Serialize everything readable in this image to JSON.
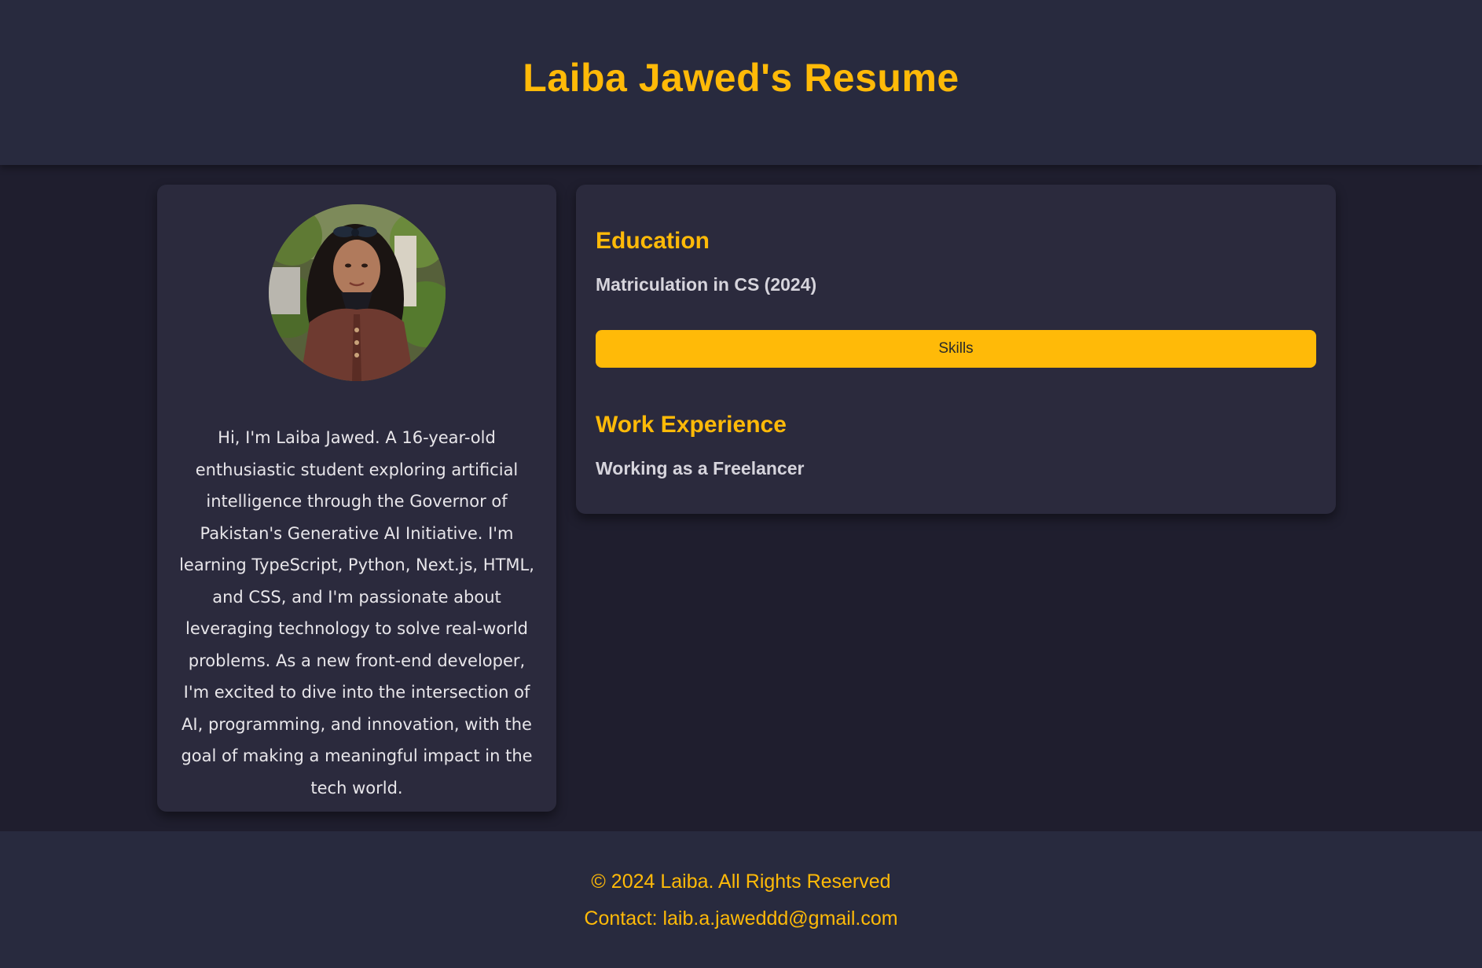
{
  "header": {
    "title": "Laiba Jawed's Resume"
  },
  "profile": {
    "photo_icon": "profile-photo",
    "bio": "Hi, I'm Laiba Jawed. A 16-year-old enthusiastic student exploring artificial intelligence through the Governor of Pakistan's Generative AI Initiative. I'm learning TypeScript, Python, Next.js, HTML, and CSS, and I'm passionate about leveraging technology to solve real-world problems. As a new front-end developer, I'm excited to dive into the intersection of AI, programming, and innovation, with the goal of making a meaningful impact in the tech world."
  },
  "education": {
    "title": "Education",
    "detail": "Matriculation in CS (2024)"
  },
  "skills": {
    "button_label": "Skills"
  },
  "work": {
    "title": "Work Experience",
    "detail": "Working as a Freelancer"
  },
  "footer": {
    "copyright": "© 2024 Laiba. All Rights Reserved",
    "contact": "Contact: laib.a.jaweddd@gmail.com"
  },
  "colors": {
    "accent": "#ffba08",
    "background": "#1f1e2e",
    "header_bg": "#282a3e",
    "card_bg": "#2b2a3d",
    "text": "#e8e6ea"
  }
}
